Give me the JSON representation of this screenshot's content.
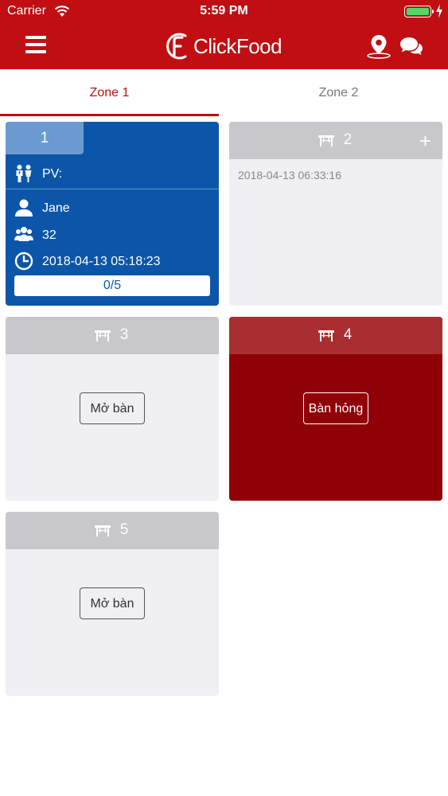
{
  "status_bar": {
    "carrier": "Carrier",
    "time": "5:59 PM",
    "battery_color": "#4cd964"
  },
  "header": {
    "brand": "ClickFood",
    "menu_icon": "hamburger-menu-icon",
    "location_icon": "map-pin-icon",
    "chat_icon": "chat-bubbles-icon",
    "color": "#c00e12"
  },
  "tabs": [
    {
      "label": "Zone 1",
      "active": true
    },
    {
      "label": "Zone 2",
      "active": false
    }
  ],
  "tables": [
    {
      "number": "1",
      "state": "occupied",
      "staff_label": "PV:",
      "customer": "Jane",
      "guests": "32",
      "opened_at": "2018-04-13 05:18:23",
      "progress": "0/5",
      "color": "#0b56a9"
    },
    {
      "number": "2",
      "state": "reserved",
      "add_label": "+",
      "timestamp": "2018-04-13 06:33:16"
    },
    {
      "number": "3",
      "state": "empty",
      "action_label": "Mở bàn"
    },
    {
      "number": "4",
      "state": "broken",
      "action_label": "Bàn hỏng",
      "color": "#900007"
    },
    {
      "number": "5",
      "state": "empty",
      "action_label": "Mở bàn"
    }
  ]
}
